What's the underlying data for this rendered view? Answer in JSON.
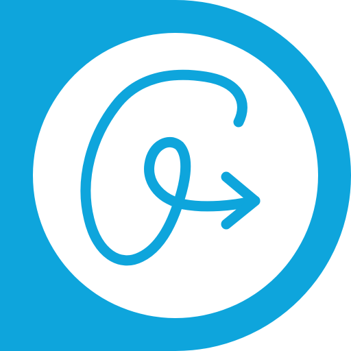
{
  "logo": {
    "icon": "looping-arrow-icon",
    "colors": {
      "brand_blue": "#0EA5DC",
      "inner_white": "#FFFFFF",
      "background": "#FFFFFF"
    }
  }
}
